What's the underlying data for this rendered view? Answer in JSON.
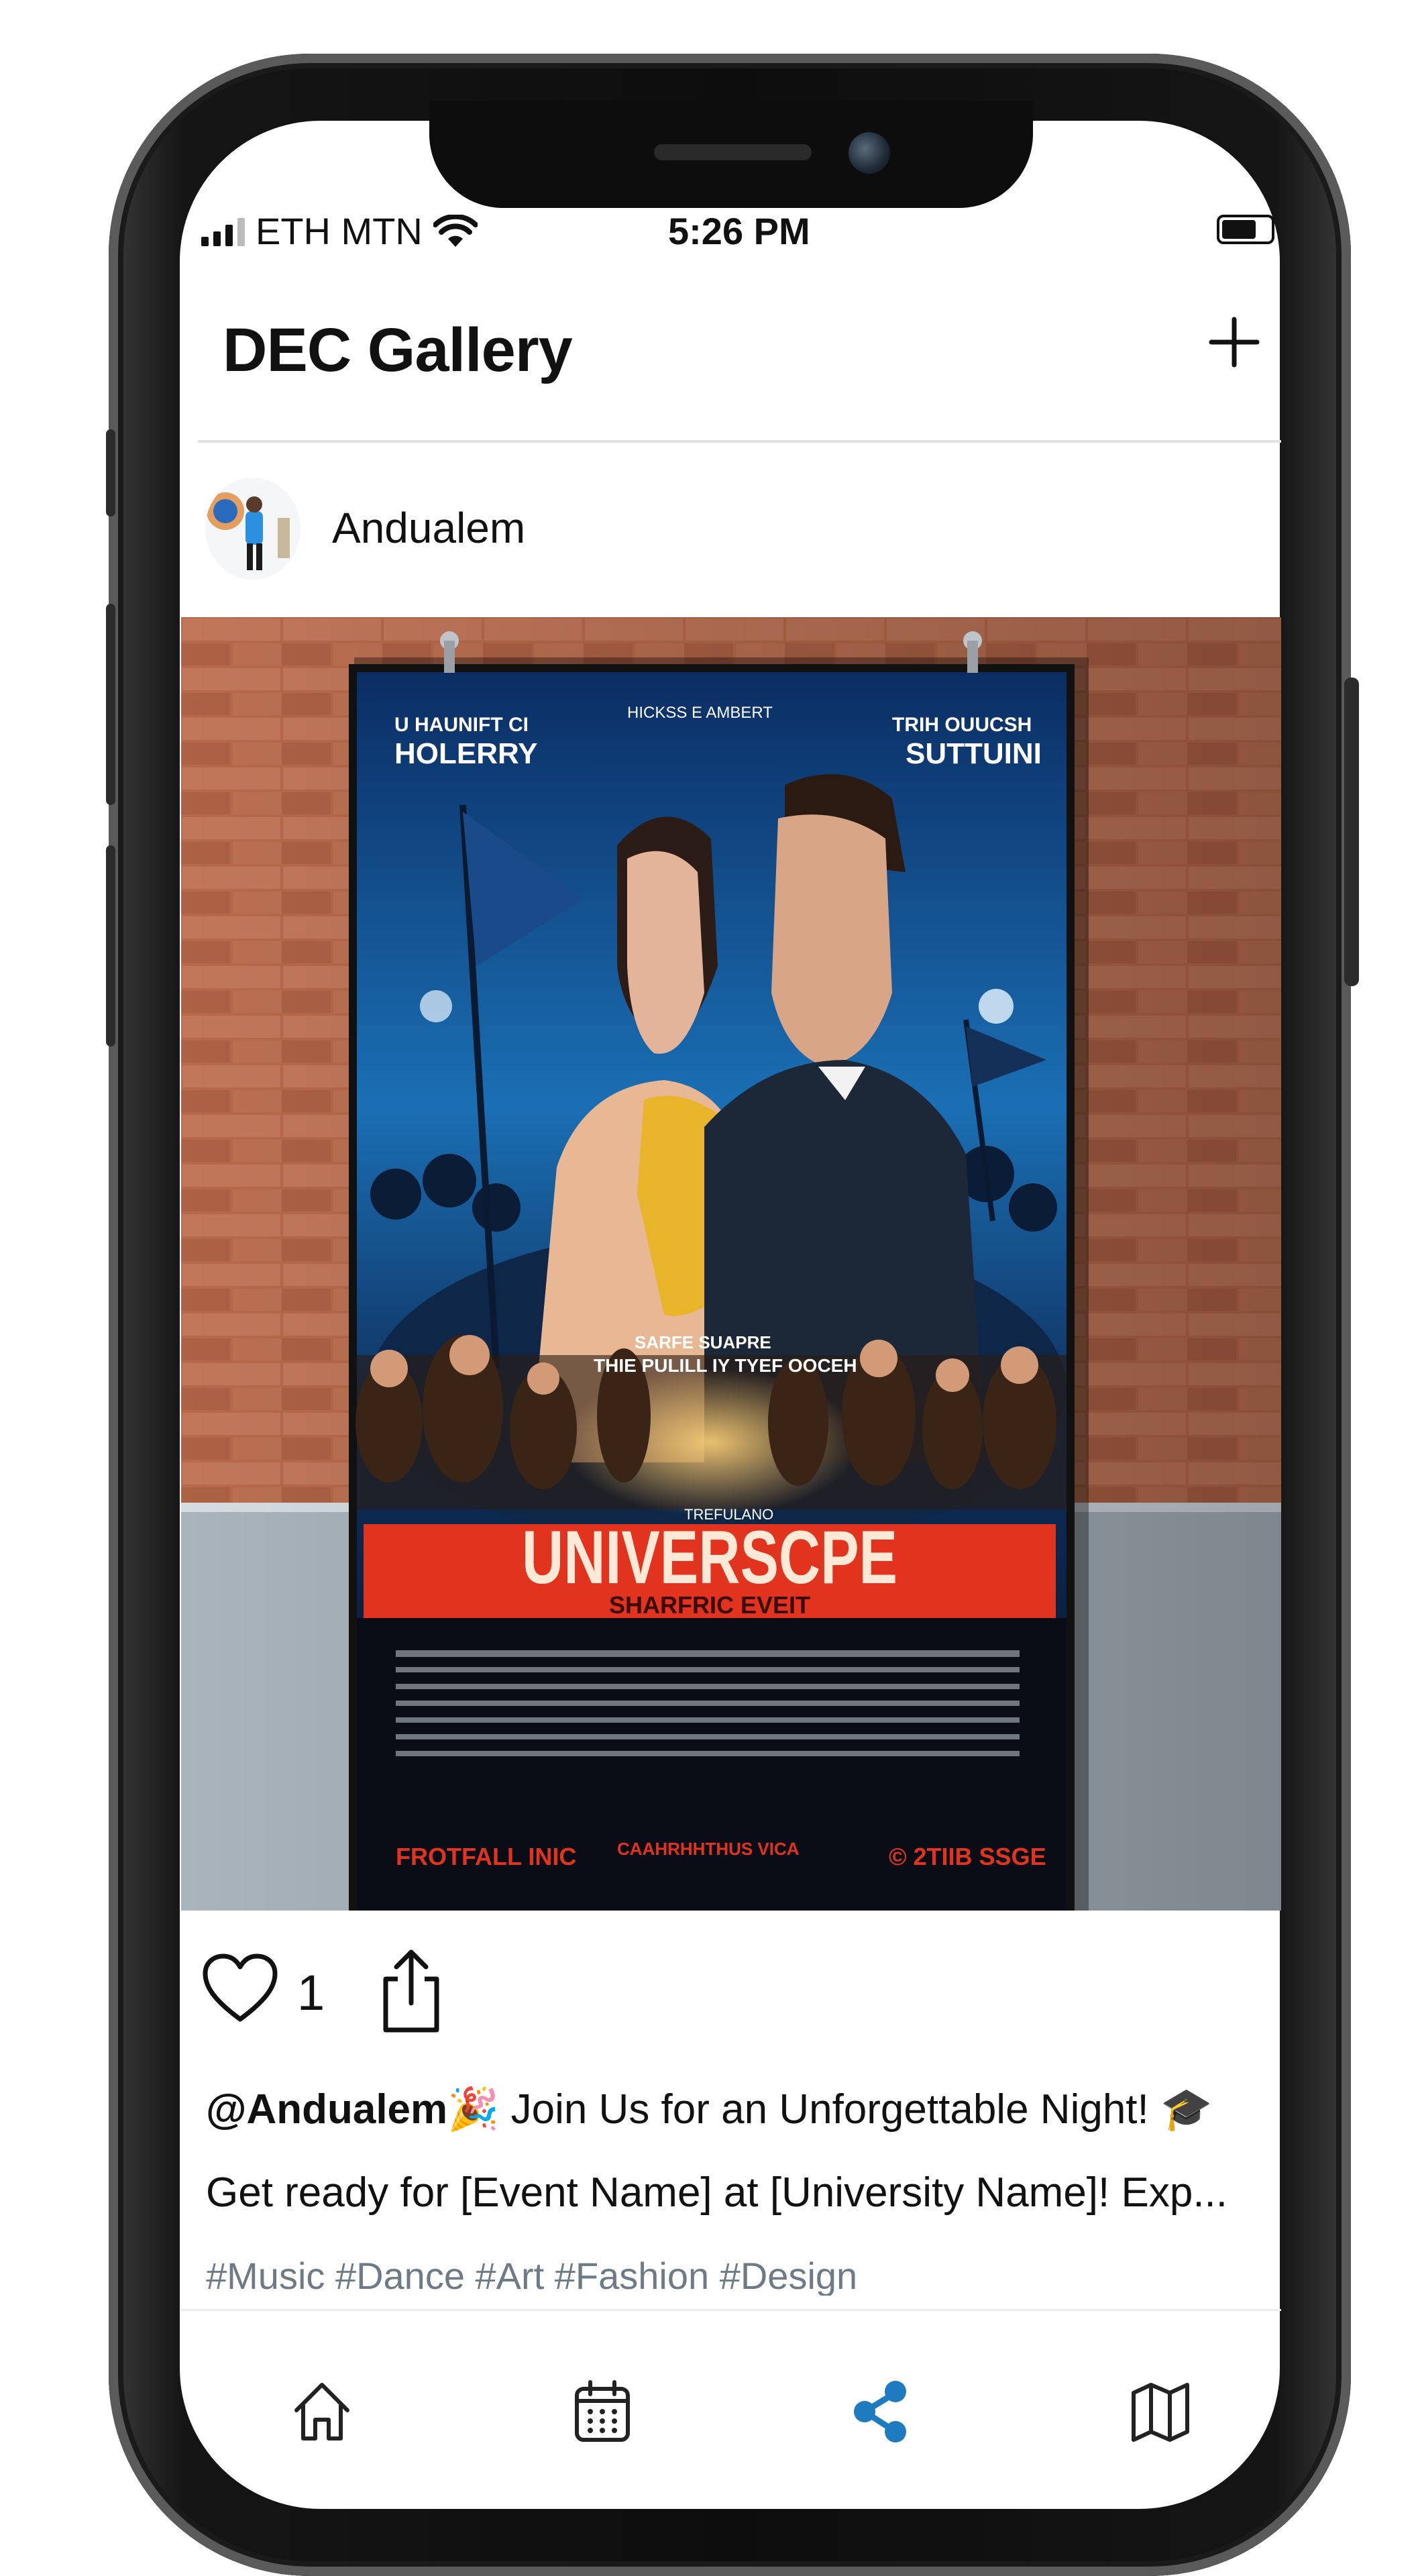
{
  "status_bar": {
    "carrier": "ETH MTN",
    "time": "5:26 PM"
  },
  "header": {
    "title": "DEC Gallery",
    "add_icon": "plus-icon"
  },
  "post": {
    "author": "Andualem",
    "image_text": {
      "top_left_line1": "U HAUNIFT CI",
      "top_left_line2": "HOLERRY",
      "top_center": "HICKSS E AMBERT",
      "top_right_line1": "TRIH OUUCSH",
      "top_right_line2": "SUTTUINI",
      "mid_line1": "SARFE SUAPRE",
      "mid_line2": "THIE PULILL IY TYEF OOCEH",
      "banner_small": "TREFULANO",
      "banner_title": "UNIVERSCPE",
      "banner_subtitle": "SHARFRIC EVEIT",
      "footer_left": "FROTFALL INIC",
      "footer_center": "CAAHRHHTHUS VICA",
      "footer_right": "© 2TIIB SSGE"
    },
    "likes": "1",
    "caption_handle": "@Andualem",
    "caption_text": "🎉 Join Us for an Unforgettable Night! 🎓",
    "description": "Get ready for [Event Name] at [University Name]! Exp...",
    "hashtags": "#Music #Dance #Art #Fashion #Design"
  },
  "tabs": [
    {
      "icon": "home-icon",
      "active": false
    },
    {
      "icon": "calendar-icon",
      "active": false
    },
    {
      "icon": "share-icon",
      "active": true
    },
    {
      "icon": "map-icon",
      "active": false
    }
  ],
  "colors": {
    "active_tab": "#1f7bc0",
    "inactive_tab": "#222222",
    "hashtag": "#6e7a86",
    "banner_red": "#e2331e"
  }
}
